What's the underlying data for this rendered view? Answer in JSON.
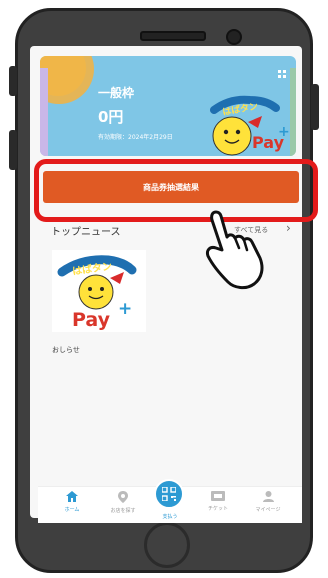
{
  "card": {
    "title": "一般枠",
    "amount": "0円",
    "expiry": "有効期限：2024年2月29日",
    "menu_icon": "grid-dots-icon",
    "logo_top_text": "はばタン",
    "logo_pay_text": "Pay",
    "logo_plus": "+",
    "colors": {
      "background": "#7fc6e6",
      "sun": "#f6b13d"
    }
  },
  "cta": {
    "label": "商品券抽選結果",
    "color": "#e05a24",
    "highlight_color": "#e31b1b"
  },
  "news": {
    "section_title": "トップニュース",
    "see_all_label": "すべて見る",
    "see_all_arrow": "›",
    "items": [
      {
        "caption": "おしらせ"
      }
    ]
  },
  "tabbar": {
    "items": [
      {
        "icon": "home-icon",
        "label": "ホーム"
      },
      {
        "icon": "map-pin-icon",
        "label": "お店を探す"
      },
      {
        "icon": "qr-code-icon",
        "label": "支払う"
      },
      {
        "icon": "ticket-icon",
        "label": "チケット"
      },
      {
        "icon": "user-icon",
        "label": "マイページ"
      }
    ],
    "active_color": "#2d9ad3"
  }
}
